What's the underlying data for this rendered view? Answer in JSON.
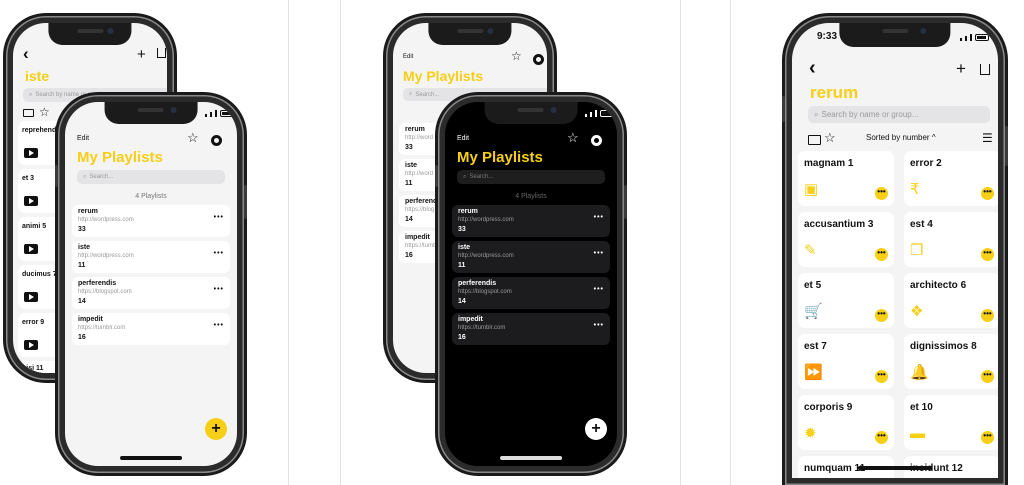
{
  "colors": {
    "accent": "#f6cf16"
  },
  "phone_left_back": {
    "back_label": "‹",
    "add_label": "+",
    "share_icon": "share-icon",
    "title": "iste",
    "search_placeholder": "Search by name or group...",
    "items": [
      {
        "label": "reprehender"
      },
      {
        "label": "et 3"
      },
      {
        "label": "animi 5"
      },
      {
        "label": "ducimus 7"
      },
      {
        "label": "error 9"
      },
      {
        "label": "nisi 11"
      }
    ]
  },
  "phone_light": {
    "edit_label": "Edit",
    "title": "My Playlists",
    "search_placeholder": "Search...",
    "count_label": "4 Playlists",
    "more_label": "•••",
    "fab_label": "+",
    "playlists": [
      {
        "name": "rerum",
        "url": "http://wordpress.com",
        "count": "33"
      },
      {
        "name": "iste",
        "url": "http://wordpress.com",
        "count": "11"
      },
      {
        "name": "perferendis",
        "url": "https://blogspot.com",
        "count": "14"
      },
      {
        "name": "impedit",
        "url": "https://tumblr.com",
        "count": "16"
      }
    ]
  },
  "phone_middle_back": {
    "edit_label": "Edit",
    "title": "My Playlists",
    "search_placeholder": "Search...",
    "items": [
      {
        "name": "rerum",
        "url": "http://word",
        "count": "33"
      },
      {
        "name": "iste",
        "url": "http://word",
        "count": "11"
      },
      {
        "name": "perferendis",
        "url": "https://blog",
        "count": "14"
      },
      {
        "name": "impedit",
        "url": "https://tumb",
        "count": "16"
      }
    ]
  },
  "phone_dark": {
    "edit_label": "Edit",
    "title": "My Playlists",
    "search_placeholder": "Search...",
    "count_label": "4 Playlists",
    "more_label": "•••",
    "fab_label": "+",
    "playlists": [
      {
        "name": "rerum",
        "url": "http://wordpress.com",
        "count": "33"
      },
      {
        "name": "iste",
        "url": "http://wordpress.com",
        "count": "11"
      },
      {
        "name": "perferendis",
        "url": "https://blogspot.com",
        "count": "14"
      },
      {
        "name": "impedit",
        "url": "https://tumblr.com",
        "count": "16"
      }
    ]
  },
  "phone_right": {
    "time": "9:33",
    "back_label": "‹",
    "add_label": "+",
    "title": "rerum",
    "search_placeholder": "Search by name or group...",
    "sort_label": "Sorted by number ^",
    "tiles": [
      {
        "title": "magnam 1",
        "icon": "image-icon",
        "glyph": "▣"
      },
      {
        "title": "error 2",
        "icon": "rupee-icon",
        "glyph": "₹"
      },
      {
        "title": "accusantium 3",
        "icon": "brush-icon",
        "glyph": "✎"
      },
      {
        "title": "est 4",
        "icon": "copy-icon",
        "glyph": "❐"
      },
      {
        "title": "et 5",
        "icon": "cart-icon",
        "glyph": "🛒"
      },
      {
        "title": "architecto 6",
        "icon": "dropbox-icon",
        "glyph": "❖"
      },
      {
        "title": "est 7",
        "icon": "fast-forward-icon",
        "glyph": "⏩"
      },
      {
        "title": "dignissimos 8",
        "icon": "bell-icon",
        "glyph": "🔔"
      },
      {
        "title": "corporis 9",
        "icon": "gear-icon",
        "glyph": "✹"
      },
      {
        "title": "et 10",
        "icon": "archive-icon",
        "glyph": "▬"
      },
      {
        "title": "numquam 11",
        "icon": "",
        "glyph": ""
      },
      {
        "title": "incidunt 12",
        "icon": "",
        "glyph": ""
      }
    ],
    "more_label": "•••"
  }
}
